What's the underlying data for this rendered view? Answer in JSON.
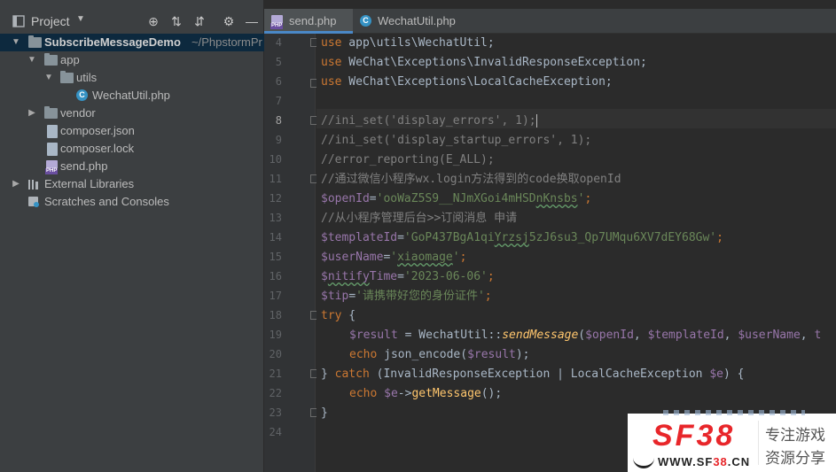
{
  "project": {
    "title": "Project",
    "root": {
      "name": "SubscribeMessageDemo",
      "path": "~/PhpstormPr"
    },
    "items": [
      {
        "name": "app"
      },
      {
        "name": "utils"
      },
      {
        "name": "WechatUtil.php"
      },
      {
        "name": "vendor"
      },
      {
        "name": "composer.json"
      },
      {
        "name": "composer.lock"
      },
      {
        "name": "send.php"
      }
    ],
    "external": "External Libraries",
    "scratches": "Scratches and Consoles"
  },
  "tabs": [
    {
      "label": "send.php",
      "icon": "php-file-icon"
    },
    {
      "label": "WechatUtil.php",
      "icon": "php-class-icon"
    }
  ],
  "editor": {
    "line_numbers": [
      "4",
      "5",
      "6",
      "7",
      "8",
      "9",
      "10",
      "11",
      "12",
      "13",
      "14",
      "15",
      "16",
      "17",
      "18",
      "19",
      "20",
      "21",
      "22",
      "23",
      "24"
    ],
    "current_line": "8",
    "lines": {
      "l4": {
        "kw": "use",
        "rest": " app\\utils\\WechatUtil;"
      },
      "l5": {
        "kw": "use",
        "rest": " WeChat\\Exceptions\\InvalidResponseException;"
      },
      "l6": {
        "kw": "use",
        "rest": " WeChat\\Exceptions\\LocalCacheException;"
      },
      "l8": "//ini_set('display_errors', 1);",
      "l9": "//ini_set('display_startup_errors', 1);",
      "l10": "//error_reporting(E_ALL);",
      "l11": "//通过微信小程序wx.login方法得到的code换取openId",
      "l12": {
        "var": "$openId",
        "eq": "=",
        "s1": "'ooWaZ5S9__NJmXGoi4mHSD",
        "s2": "nKnsbs",
        "s3": "'",
        "end": ";"
      },
      "l13": "//从小程序管理后台>>订阅消息 申请",
      "l14": {
        "var": "$templateId",
        "eq": "=",
        "s1": "'GoP437BgA1qi",
        "s2": "Yrzsj",
        "s3": "5zJ6su3_Qp7UMqu6XV7dEY68Gw'",
        "end": ";"
      },
      "l15": {
        "var": "$userName",
        "eq": "=",
        "s1": "'",
        "s2": "xiaomage",
        "s3": "'",
        "end": ";"
      },
      "l16": {
        "var1": "$",
        "var2": "nitify",
        "var3": "Time",
        "eq": "=",
        "str": "'2023-06-06'",
        "end": ";"
      },
      "l17": {
        "var": "$tip",
        "eq": "=",
        "str": "'请携带好您的身份证件'",
        "end": ";"
      },
      "l18": {
        "kw": "try",
        "rest": " {"
      },
      "l19": {
        "var": "$result",
        "p1": " = WechatUtil::",
        "fn": "sendMessage",
        "p2": "(",
        "a1": "$openId",
        "c1": ", ",
        "a2": "$templateId",
        "c2": ", ",
        "a3": "$userName",
        "c3": ", ",
        "a4": "t"
      },
      "l20": {
        "kw": "echo",
        "p1": " json_encode(",
        "var": "$result",
        "p2": ");"
      },
      "l21": {
        "p1": "} ",
        "kw": "catch",
        "p2": " (InvalidResponseException | LocalCacheException ",
        "var": "$e",
        "p3": ") {"
      },
      "l22": {
        "kw": "echo",
        "p1": " ",
        "var": "$e",
        "p2": "->",
        "fn": "getMessage",
        "p3": "();"
      },
      "l23": "}"
    }
  },
  "watermark": {
    "logo": "SF38",
    "url_a": "WWW.SF",
    "url_b": "38",
    "url_c": ".CN",
    "line1": "专注游戏",
    "line2": "资源分享"
  },
  "colors": {
    "keyword": "#cc7832",
    "variable": "#9876aa",
    "string": "#6a8759",
    "comment": "#808080",
    "function": "#ffc66d",
    "brand_red": "#e8262a"
  }
}
